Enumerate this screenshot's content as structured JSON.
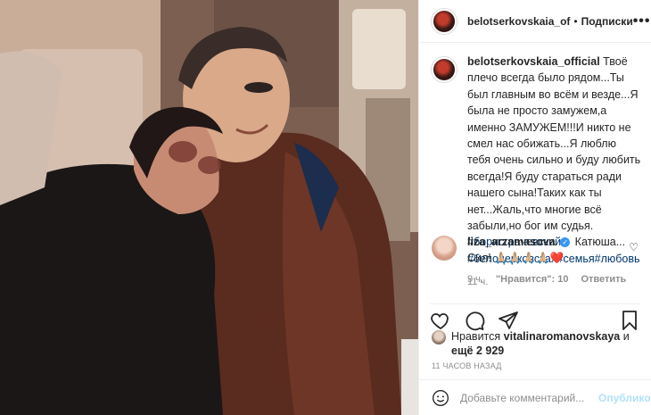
{
  "header": {
    "username": "belotserkovskaia_of",
    "separator": "•",
    "follow_label": "Подписки",
    "more_label": "•••"
  },
  "caption": {
    "username": "belotserkovskaia_official",
    "text": "Твоё плечо всегда было рядом...Ты был главным во всём и везде...Я была не просто замужем,а именно ЗАМУЖЕМ!!!И никто не смел нас обижать...Я люблю тебя очень сильно и буду любить всегда!Я буду стараться ради нашего сына!Таких как ты нет...Жаль,что многие всё забыли,но бог им судья.",
    "tags": [
      "#борисграчевский",
      "#белоцерковская",
      "#семья",
      "#любовь"
    ],
    "time": "11 ч."
  },
  "comment": {
    "username": "liza_arzamasova",
    "text": "Катюша... Сил! 🙏🏼🙏🏼🙏🏼🙏🏼❤️",
    "time": "9 ч.",
    "likes": "\"Нравится\": 10",
    "reply": "Ответить"
  },
  "likes": {
    "prefix": "Нравится ",
    "user": "vitalinaromanovskaya",
    "middle": " и",
    "rest_prefix": "ещё ",
    "count": "2 929"
  },
  "posted_ago": "11 часов назад",
  "composer": {
    "placeholder": "Добавьте комментарий...",
    "post_label": "Опубликовать"
  },
  "colors": {
    "tag": "#00376b",
    "muted": "#8e8e8e",
    "post_disabled": "#b2dffc",
    "heart_red": "#ed4956"
  },
  "icons": [
    "more-icon",
    "heart-icon",
    "comment-icon",
    "share-icon",
    "bookmark-icon",
    "emoji-icon",
    "verified-icon"
  ]
}
